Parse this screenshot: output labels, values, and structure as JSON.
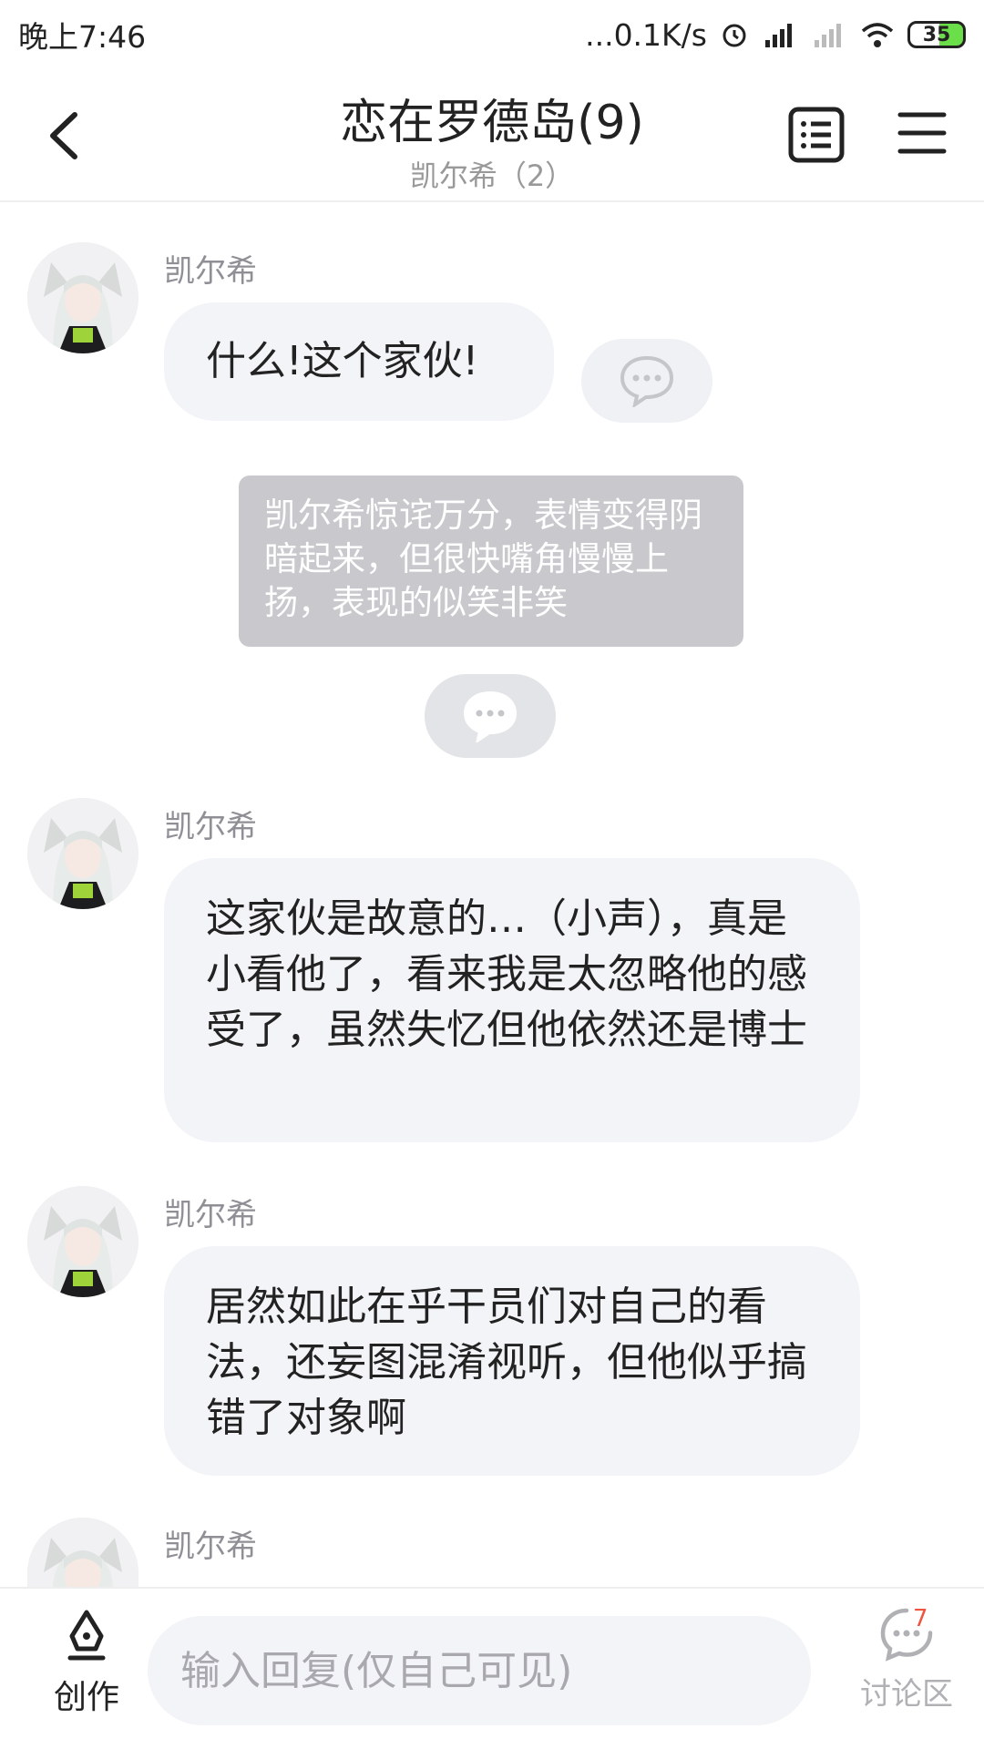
{
  "status": {
    "time": "晚上7:46",
    "network_speed": "...0.1K/s",
    "battery": "35",
    "icons": [
      "alarm-icon",
      "hd-signal-icon",
      "signal-icon",
      "wifi-icon",
      "battery-icon"
    ]
  },
  "header": {
    "title": "恋在罗德岛(9)",
    "subtitle": "凯尔希（2）"
  },
  "messages": [
    {
      "name": "凯尔希",
      "text": "什么!这个家伙!"
    },
    {
      "name": "凯尔希",
      "text": "这家伙是故意的…（小声），真是小看他了，看来我是太忽略他的感受了，虽然失忆但他依然还是博士"
    },
    {
      "name": "凯尔希",
      "text": "居然如此在乎干员们对自己的看法，还妄图混淆视听，但他似乎搞错了对象啊"
    },
    {
      "name": "凯尔希"
    }
  ],
  "narration": {
    "text": "凯尔希惊诧万分，表情变得阴暗起来，但很快嘴角慢慢上扬，表现的似笑非笑"
  },
  "bottom": {
    "create_label": "创作",
    "input_placeholder": "输入回复(仅自己可见)",
    "discussion_label": "讨论区",
    "discussion_count": "7"
  },
  "colors": {
    "bubble": "#f3f4f7",
    "narration": "#c9c9cd",
    "badge": "#f0533e",
    "battery_fill": "#6adf4a"
  }
}
